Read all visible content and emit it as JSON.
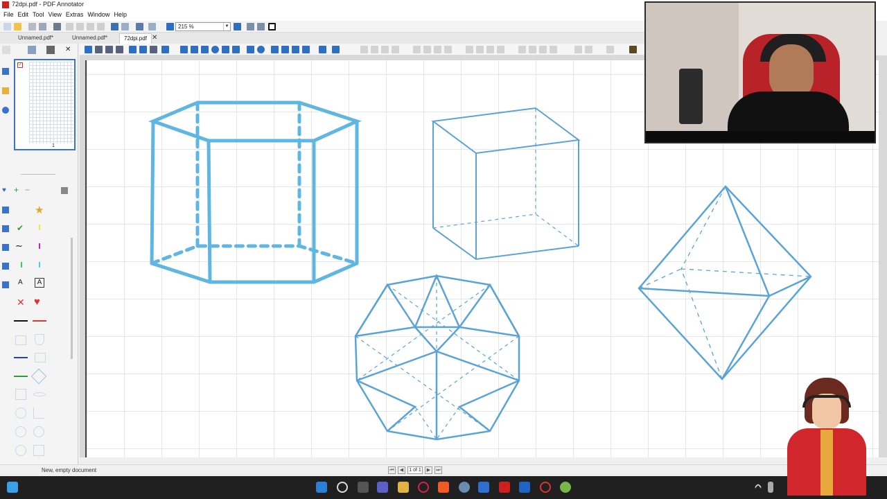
{
  "window": {
    "title": "72dpi.pdf - PDF Annotator"
  },
  "menu": [
    "File",
    "Edit",
    "Tool",
    "View",
    "Extras",
    "Window",
    "Help"
  ],
  "toolbar": {
    "zoom_value": "215 %"
  },
  "tabs": [
    {
      "label": "Unnamed.pdf*",
      "active": false
    },
    {
      "label": "Unnamed.pdf*",
      "active": false
    },
    {
      "label": "72dpi.pdf",
      "active": true
    }
  ],
  "thumbnail": {
    "page_label": "1"
  },
  "status": {
    "text": "New, empty document",
    "page_indicator": "1 of 1"
  },
  "colors": {
    "accent": "#1a73c8",
    "stroke": "#5aa3d6",
    "grid": "#cfcfcf",
    "brand": "#d01f1f"
  },
  "icons": [
    "new-doc-icon",
    "open-icon",
    "save-icon",
    "print-icon",
    "undo-icon",
    "redo-icon",
    "pen-icon",
    "highlighter-icon",
    "eraser-icon",
    "line-icon",
    "arrow-icon",
    "rectangle-icon",
    "ellipse-icon",
    "star-icon",
    "check-icon",
    "cross-icon",
    "heart-icon"
  ],
  "shapes": [
    "hexagonal-prism",
    "cube",
    "octahedron",
    "icosahedron"
  ]
}
